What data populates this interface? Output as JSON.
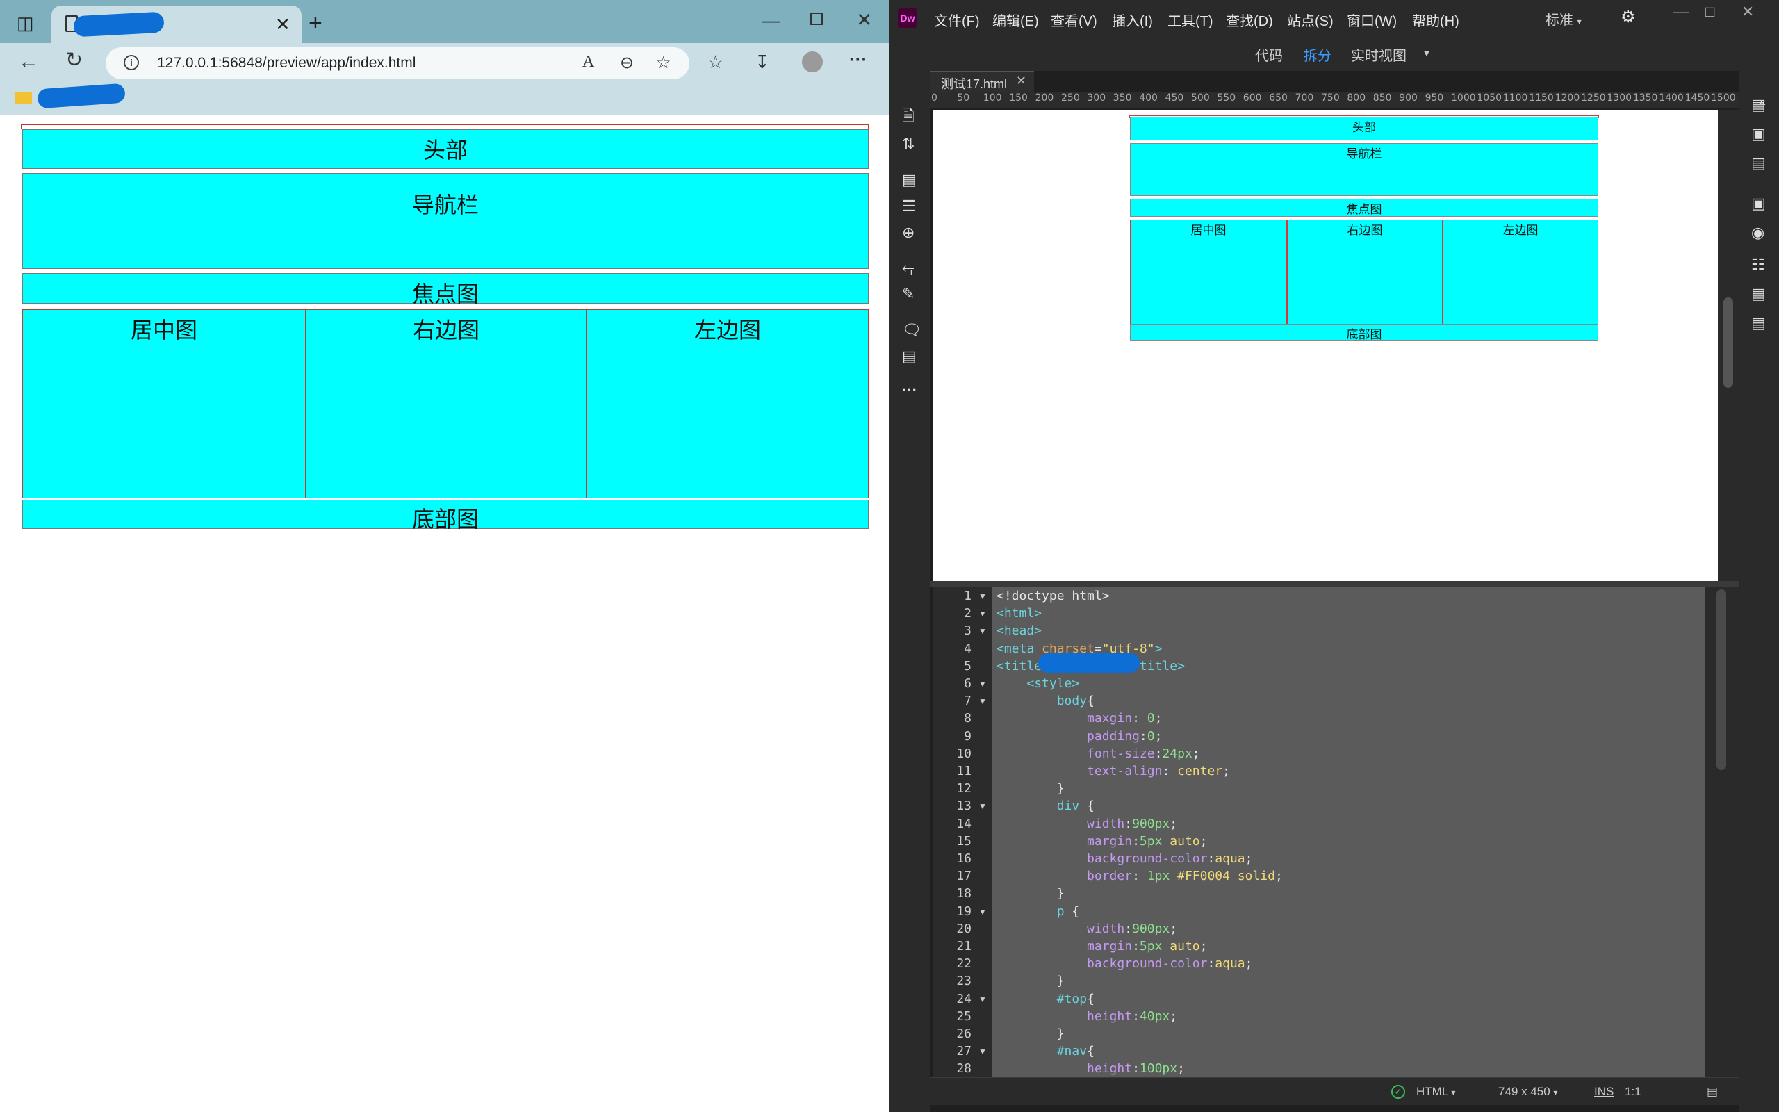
{
  "browser": {
    "address": {
      "url": "127.0.0.1:56848/preview/app/index.html"
    },
    "icons": {
      "sidebar": "sidebar-icon",
      "page": "page-icon",
      "back": "back-arrow-icon",
      "refresh": "refresh-icon",
      "info": "i",
      "read_aloud": "A",
      "zoom": "zoom-out-icon",
      "favorite_add": "add-favorite-icon",
      "favorites": "favorites-icon",
      "downloads": "download-icon",
      "more": "···"
    }
  },
  "page": {
    "header": "头部",
    "nav": "导航栏",
    "focus": "焦点图",
    "center": "居中图",
    "right": "右边图",
    "left": "左边图",
    "footer": "底部图",
    "colors": {
      "box_bg": "#00FFFF",
      "border_red": "#FF0004"
    }
  },
  "dw": {
    "logo": "Dw",
    "menus": [
      "文件(F)",
      "编辑(E)",
      "查看(V)",
      "插入(I)",
      "工具(T)",
      "查找(D)",
      "站点(S)",
      "窗口(W)",
      "帮助(H)"
    ],
    "workspace": "标准",
    "views": {
      "code": "代码",
      "split": "拆分",
      "live": "实时视图"
    },
    "doc_tab": "测试17.html",
    "ruler": [
      "0",
      "50",
      "100",
      "150",
      "200",
      "250",
      "300",
      "350",
      "400",
      "450",
      "500",
      "550",
      "600",
      "650",
      "700",
      "750",
      "800",
      "850",
      "900",
      "950",
      "1000",
      "1050",
      "1100",
      "1150",
      "1200",
      "1250",
      "1300",
      "1350",
      "1400",
      "1450",
      "1500"
    ],
    "status": {
      "language": "HTML",
      "size": "749 x 450",
      "mode": "INS",
      "position": "1:1"
    },
    "code": [
      {
        "n": "1",
        "parts": [
          [
            "c-pl",
            "<!doctype html>"
          ]
        ]
      },
      {
        "n": "2",
        "parts": [
          [
            "c-tag",
            "<html>"
          ]
        ]
      },
      {
        "n": "3",
        "parts": [
          [
            "c-tag",
            "<head>"
          ]
        ]
      },
      {
        "n": "4",
        "parts": [
          [
            "c-tag",
            "<meta "
          ],
          [
            "c-attr",
            "charset"
          ],
          [
            "c-pl",
            "="
          ],
          [
            "c-str",
            "\"utf-8\""
          ],
          [
            "c-tag",
            ">"
          ]
        ]
      },
      {
        "n": "5",
        "parts": [
          [
            "c-tag",
            "<title"
          ],
          [
            "c-pl",
            "            "
          ],
          [
            "c-tag",
            "/title>"
          ]
        ]
      },
      {
        "n": "6",
        "parts": [
          [
            "c-pl",
            "    "
          ],
          [
            "c-tag",
            "<style>"
          ]
        ]
      },
      {
        "n": "7",
        "parts": [
          [
            "c-pl",
            "        "
          ],
          [
            "c-sel",
            "body"
          ],
          [
            "c-pl",
            "{"
          ]
        ]
      },
      {
        "n": "8",
        "parts": [
          [
            "c-pl",
            "            "
          ],
          [
            "c-prop",
            "maxgin"
          ],
          [
            "c-pl",
            ": "
          ],
          [
            "c-num",
            "0"
          ],
          [
            "c-pl",
            ";"
          ]
        ]
      },
      {
        "n": "9",
        "parts": [
          [
            "c-pl",
            "            "
          ],
          [
            "c-prop",
            "padding"
          ],
          [
            "c-pl",
            ":"
          ],
          [
            "c-num",
            "0"
          ],
          [
            "c-pl",
            ";"
          ]
        ]
      },
      {
        "n": "10",
        "parts": [
          [
            "c-pl",
            "            "
          ],
          [
            "c-prop",
            "font-size"
          ],
          [
            "c-pl",
            ":"
          ],
          [
            "c-num",
            "24px"
          ],
          [
            "c-pl",
            ";"
          ]
        ]
      },
      {
        "n": "11",
        "parts": [
          [
            "c-pl",
            "            "
          ],
          [
            "c-prop",
            "text-align"
          ],
          [
            "c-pl",
            ": "
          ],
          [
            "c-val",
            "center"
          ],
          [
            "c-pl",
            ";"
          ]
        ]
      },
      {
        "n": "12",
        "parts": [
          [
            "c-pl",
            "        }"
          ]
        ]
      },
      {
        "n": "13",
        "parts": [
          [
            "c-pl",
            "        "
          ],
          [
            "c-sel",
            "div"
          ],
          [
            "c-pl",
            " {"
          ]
        ]
      },
      {
        "n": "14",
        "parts": [
          [
            "c-pl",
            "            "
          ],
          [
            "c-prop",
            "width"
          ],
          [
            "c-pl",
            ":"
          ],
          [
            "c-num",
            "900px"
          ],
          [
            "c-pl",
            ";"
          ]
        ]
      },
      {
        "n": "15",
        "parts": [
          [
            "c-pl",
            "            "
          ],
          [
            "c-prop",
            "margin"
          ],
          [
            "c-pl",
            ":"
          ],
          [
            "c-num",
            "5px"
          ],
          [
            "c-pl",
            " "
          ],
          [
            "c-val",
            "auto"
          ],
          [
            "c-pl",
            ";"
          ]
        ]
      },
      {
        "n": "16",
        "parts": [
          [
            "c-pl",
            "            "
          ],
          [
            "c-prop",
            "background-color"
          ],
          [
            "c-pl",
            ":"
          ],
          [
            "c-val",
            "aqua"
          ],
          [
            "c-pl",
            ";"
          ]
        ]
      },
      {
        "n": "17",
        "parts": [
          [
            "c-pl",
            "            "
          ],
          [
            "c-prop",
            "border"
          ],
          [
            "c-pl",
            ": "
          ],
          [
            "c-num",
            "1px"
          ],
          [
            "c-pl",
            " "
          ],
          [
            "c-val",
            "#FF0004"
          ],
          [
            "c-pl",
            " "
          ],
          [
            "c-val",
            "solid"
          ],
          [
            "c-pl",
            ";"
          ]
        ]
      },
      {
        "n": "18",
        "parts": [
          [
            "c-pl",
            "        }"
          ]
        ]
      },
      {
        "n": "19",
        "parts": [
          [
            "c-pl",
            "        "
          ],
          [
            "c-sel",
            "p"
          ],
          [
            "c-pl",
            " {"
          ]
        ]
      },
      {
        "n": "20",
        "parts": [
          [
            "c-pl",
            "            "
          ],
          [
            "c-prop",
            "width"
          ],
          [
            "c-pl",
            ":"
          ],
          [
            "c-num",
            "900px"
          ],
          [
            "c-pl",
            ";"
          ]
        ]
      },
      {
        "n": "21",
        "parts": [
          [
            "c-pl",
            "            "
          ],
          [
            "c-prop",
            "margin"
          ],
          [
            "c-pl",
            ":"
          ],
          [
            "c-num",
            "5px"
          ],
          [
            "c-pl",
            " "
          ],
          [
            "c-val",
            "auto"
          ],
          [
            "c-pl",
            ";"
          ]
        ]
      },
      {
        "n": "22",
        "parts": [
          [
            "c-pl",
            "            "
          ],
          [
            "c-prop",
            "background-color"
          ],
          [
            "c-pl",
            ":"
          ],
          [
            "c-val",
            "aqua"
          ],
          [
            "c-pl",
            ";"
          ]
        ]
      },
      {
        "n": "23",
        "parts": [
          [
            "c-pl",
            "        }"
          ]
        ]
      },
      {
        "n": "24",
        "parts": [
          [
            "c-pl",
            "        "
          ],
          [
            "c-sel",
            "#top"
          ],
          [
            "c-pl",
            "{"
          ]
        ]
      },
      {
        "n": "25",
        "parts": [
          [
            "c-pl",
            "            "
          ],
          [
            "c-prop",
            "height"
          ],
          [
            "c-pl",
            ":"
          ],
          [
            "c-num",
            "40px"
          ],
          [
            "c-pl",
            ";"
          ]
        ]
      },
      {
        "n": "26",
        "parts": [
          [
            "c-pl",
            "        }"
          ]
        ]
      },
      {
        "n": "27",
        "parts": [
          [
            "c-pl",
            "        "
          ],
          [
            "c-sel",
            "#nav"
          ],
          [
            "c-pl",
            "{"
          ]
        ]
      },
      {
        "n": "28",
        "parts": [
          [
            "c-pl",
            "            "
          ],
          [
            "c-prop",
            "height"
          ],
          [
            "c-pl",
            ":"
          ],
          [
            "c-num",
            "100px"
          ],
          [
            "c-pl",
            ";"
          ]
        ]
      }
    ],
    "folds": [
      "1",
      "2",
      "3",
      "6",
      "7",
      "13",
      "19",
      "24",
      "27"
    ]
  }
}
